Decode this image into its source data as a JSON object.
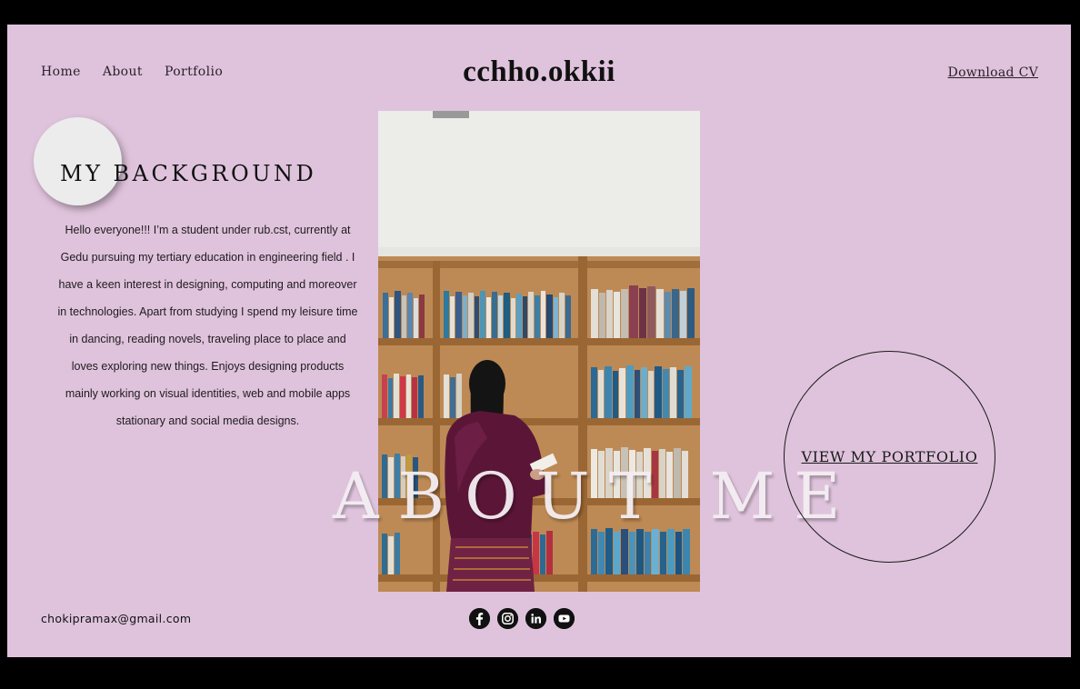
{
  "nav": {
    "home": "Home",
    "about": "About",
    "portfolio": "Portfolio"
  },
  "logo": "cchho.okkii",
  "download_cv": "Download CV",
  "background": {
    "heading": "MY BACKGROUND",
    "bio": "Hello everyone!!! I’m a student under rub.cst, currently at Gedu pursuing my tertiary education in engineering field . I have a keen interest in designing, computing and moreover in technologies. Apart from studying I spend my leisure time in dancing, reading novels, traveling place to place and loves exploring new things. Enjoys designing products mainly working on visual identities, web and mobile apps stationary and social media designs."
  },
  "about_title": "ABOUT ME",
  "view_portfolio": "VIEW MY PORTFOLIO",
  "email": "chokipramax@gmail.com",
  "social": [
    "facebook-icon",
    "instagram-icon",
    "linkedin-icon",
    "youtube-icon"
  ],
  "colors": {
    "background": "#dfc3dc",
    "frame_outer": "#000000",
    "text": "#111111"
  }
}
